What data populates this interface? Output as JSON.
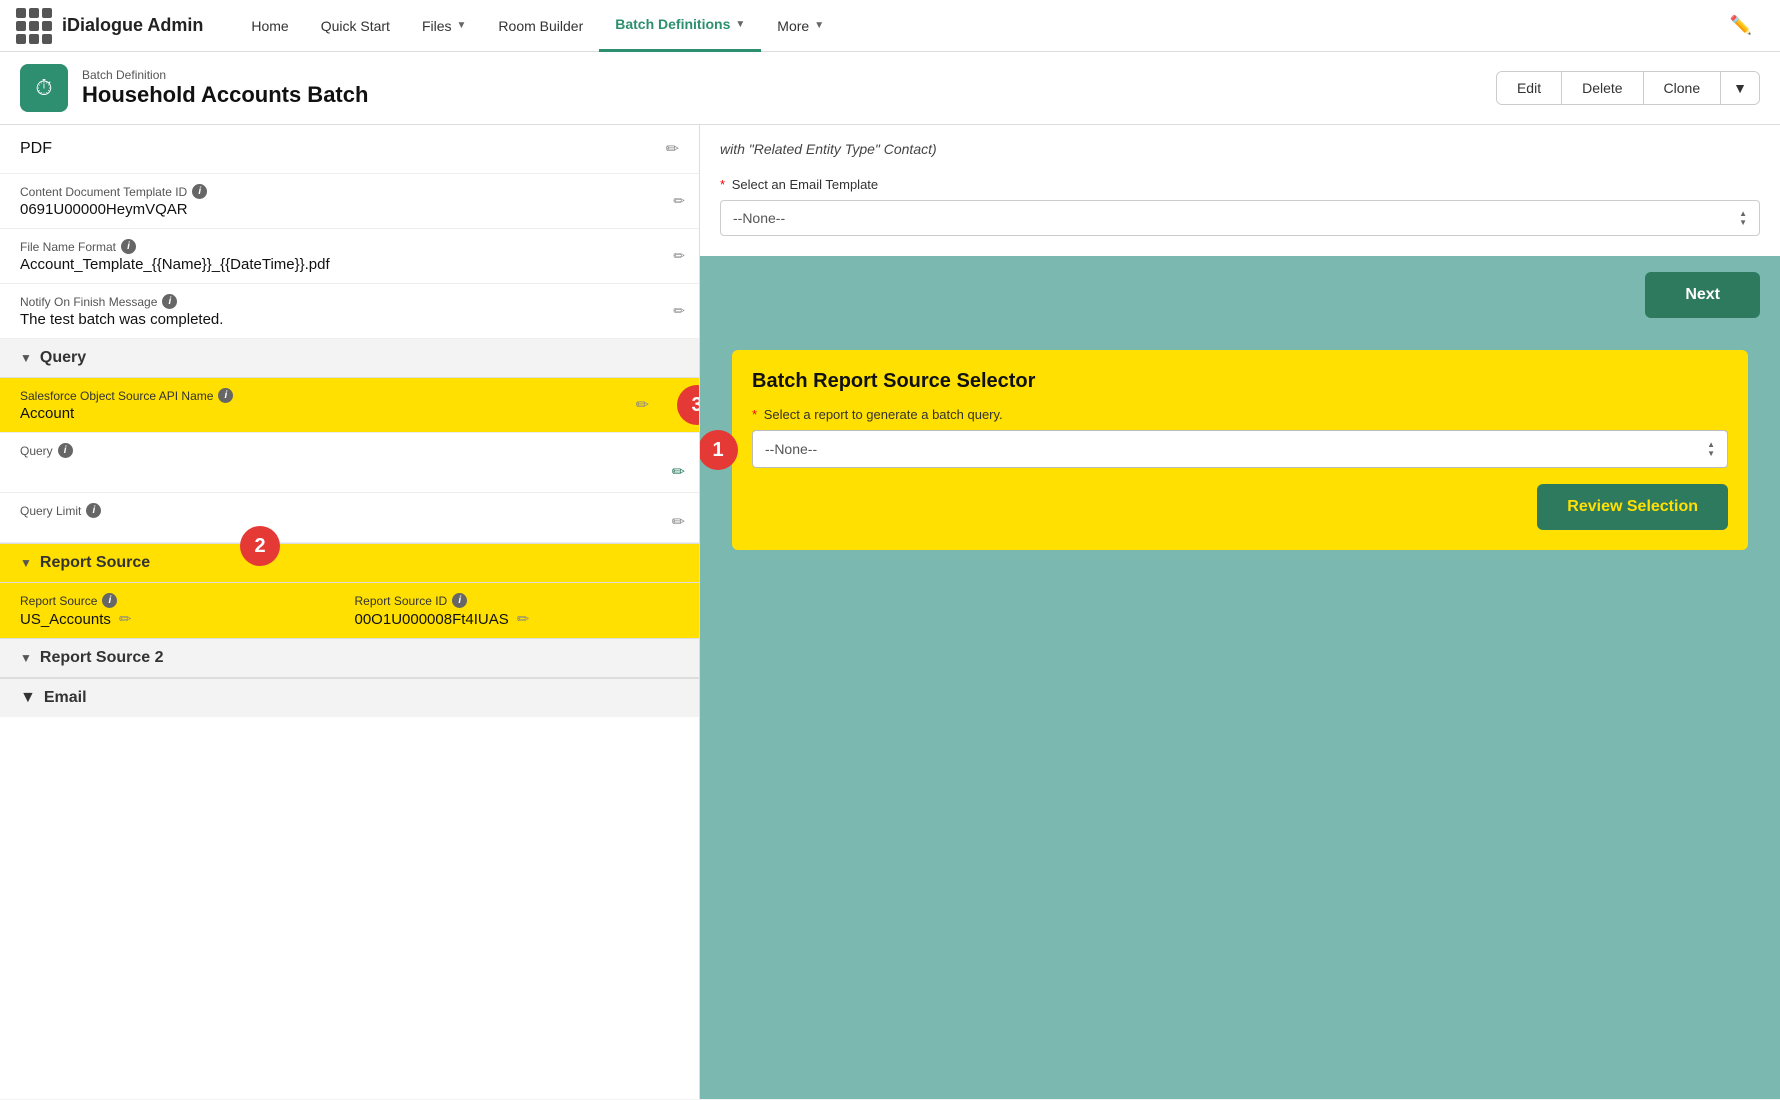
{
  "nav": {
    "app_name": "iDialogue Admin",
    "links": [
      {
        "label": "Home",
        "active": false
      },
      {
        "label": "Quick Start",
        "active": false
      },
      {
        "label": "Files",
        "active": false,
        "has_dropdown": true
      },
      {
        "label": "Room Builder",
        "active": false
      },
      {
        "label": "Batch Definitions",
        "active": true,
        "has_dropdown": true
      },
      {
        "label": "More",
        "active": false,
        "has_dropdown": true
      }
    ]
  },
  "page_header": {
    "subtitle": "Batch Definition",
    "title": "Household Accounts Batch",
    "actions": {
      "edit": "Edit",
      "delete": "Delete",
      "clone": "Clone"
    }
  },
  "left_panel": {
    "pdf_label": "PDF",
    "fields": [
      {
        "label": "Content Document Template ID",
        "value": "0691U00000HeymVQAR",
        "has_info": true
      },
      {
        "label": "File Name Format",
        "value": "Account_Template_{{Name}}_{{DateTime}}.pdf",
        "has_info": true
      },
      {
        "label": "Notify On Finish Message",
        "value": "The test batch was completed.",
        "has_info": true
      }
    ],
    "query_section": {
      "label": "Query",
      "fields": [
        {
          "label": "Salesforce Object Source API Name",
          "value": "Account",
          "highlighted": true,
          "has_info": true
        },
        {
          "label": "Query",
          "value": "",
          "has_info": true,
          "has_edit_pencil": true
        },
        {
          "label": "Query Limit",
          "value": "",
          "has_info": true
        }
      ]
    },
    "report_source_section": {
      "label": "Report Source",
      "badge": "2",
      "fields": [
        {
          "label": "Report Source",
          "value": "US_Accounts",
          "has_info": true
        },
        {
          "label": "Report Source ID",
          "value": "00O1U000008Ft4IUAS",
          "has_info": true
        }
      ]
    },
    "report_source_2": {
      "label": "Report Source 2"
    },
    "email_section": {
      "label": "Email"
    }
  },
  "right_panel": {
    "top_text": "with \"Related Entity Type\" Contact)",
    "email_template": {
      "label": "Select an Email Template",
      "placeholder": "--None--",
      "required": true
    },
    "next_button": "Next",
    "batch_selector": {
      "badge": "1",
      "title": "Batch Report Source Selector",
      "select_label": "Select a report to generate a batch query.",
      "select_placeholder": "--None--",
      "required": true,
      "review_button": "Review Selection"
    }
  },
  "badges": {
    "colors": {
      "red": "#e53935"
    }
  }
}
